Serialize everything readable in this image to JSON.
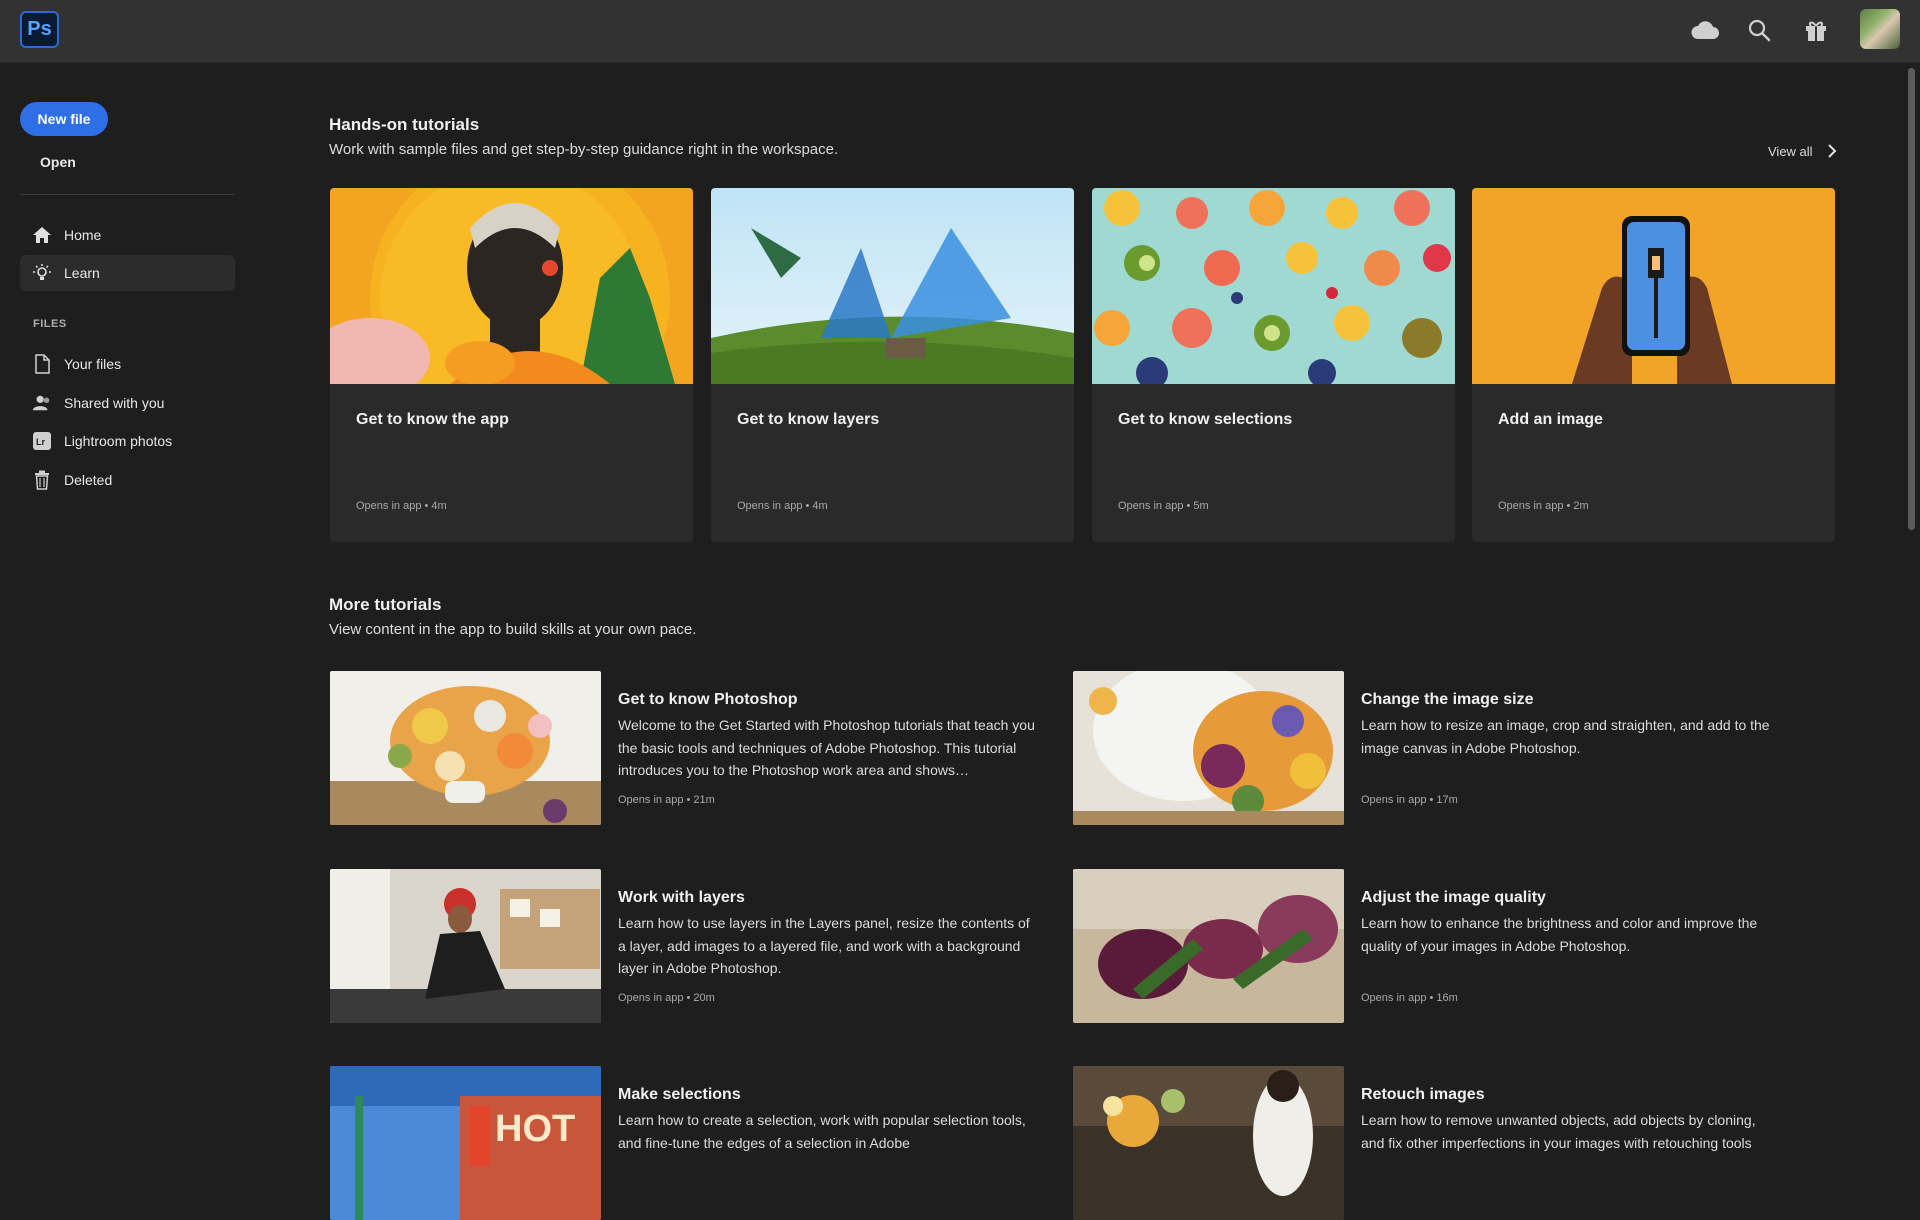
{
  "app": {
    "logo_text": "Ps",
    "accent": "#2f6fe6"
  },
  "topbar": {
    "icons": [
      "cloud-icon",
      "search-icon",
      "gift-icon",
      "avatar"
    ]
  },
  "sidebar": {
    "new_file": "New file",
    "open": "Open",
    "nav": [
      {
        "label": "Home",
        "icon": "home-icon"
      },
      {
        "label": "Learn",
        "icon": "lightbulb-icon",
        "active": true
      }
    ],
    "files_header": "FILES",
    "files": [
      {
        "label": "Your files",
        "icon": "file-icon"
      },
      {
        "label": "Shared with you",
        "icon": "people-icon"
      },
      {
        "label": "Lightroom photos",
        "icon": "lightroom-icon"
      },
      {
        "label": "Deleted",
        "icon": "trash-icon"
      }
    ]
  },
  "hands_on": {
    "title": "Hands-on tutorials",
    "subtitle": "Work with sample files and get step-by-step guidance right in the workspace.",
    "view_all": "View all",
    "cards": [
      {
        "title": "Get to know the app",
        "meta": "Opens in app  •  4m"
      },
      {
        "title": "Get to know layers",
        "meta": "Opens in app  •  4m"
      },
      {
        "title": "Get to know selections",
        "meta": "Opens in app  •  5m"
      },
      {
        "title": "Add an image",
        "meta": "Opens in app  •  2m"
      }
    ]
  },
  "more": {
    "title": "More tutorials",
    "subtitle": "View content in the app to build skills at your own pace.",
    "items": [
      {
        "title": "Get to know Photoshop",
        "desc": "Welcome to the Get Started with Photoshop tutorials that teach you the basic tools and techniques of Adobe Photoshop. This tutorial introduces you to the Photoshop work area and shows…",
        "meta": "Opens in app  •  21m"
      },
      {
        "title": "Change the image size",
        "desc": "Learn how to resize an image, crop and straighten, and add to the image canvas in Adobe Photoshop.",
        "meta": "Opens in app  •  17m"
      },
      {
        "title": "Work with layers",
        "desc": "Learn how to use layers in the Layers panel, resize the contents of a layer, add images to a layered file, and work with a background layer in Adobe Photoshop.",
        "meta": "Opens in app  •  20m"
      },
      {
        "title": "Adjust the image quality",
        "desc": "Learn how to enhance the brightness and color and improve the quality of your images in Adobe Photoshop.",
        "meta": "Opens in app  •  16m"
      },
      {
        "title": "Make selections",
        "desc": "Learn how to create a selection, work with popular selection tools, and fine-tune the edges of a selection in Adobe",
        "meta": ""
      },
      {
        "title": "Retouch images",
        "desc": "Learn how to remove unwanted objects, add objects by cloning, and fix other imperfections in your images with retouching tools",
        "meta": ""
      }
    ],
    "thumb_signs": {
      "hot": "HOT"
    }
  }
}
